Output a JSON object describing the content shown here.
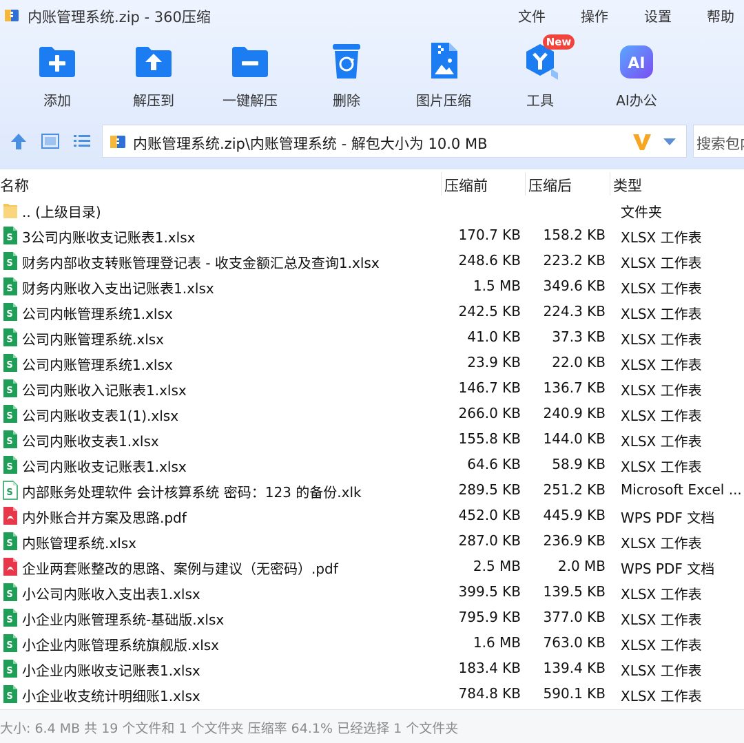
{
  "window": {
    "title": "内账管理系统.zip - 360压缩"
  },
  "menu": [
    "文件",
    "操作",
    "设置",
    "帮助"
  ],
  "toolbar": {
    "buttons": [
      {
        "label": "添加",
        "icon": "add-folder-icon"
      },
      {
        "label": "解压到",
        "icon": "extract-to-icon"
      },
      {
        "label": "一键解压",
        "icon": "one-click-extract-icon"
      },
      {
        "label": "删除",
        "icon": "trash-icon"
      },
      {
        "label": "图片压缩",
        "icon": "image-compress-icon"
      },
      {
        "label": "工具",
        "icon": "tools-icon"
      },
      {
        "label": "AI办公",
        "icon": "ai-office-icon"
      }
    ],
    "new_badge": "New",
    "ai_icon_text": "AI"
  },
  "address": {
    "path": "内账管理系统.zip\\内账管理系统 - 解包大小为 10.0 MB",
    "search_placeholder": "搜索包内"
  },
  "columns": {
    "name": "名称",
    "before": "压缩前",
    "after": "压缩后",
    "type": "类型"
  },
  "files": [
    {
      "name": ".. (上级目录)",
      "before": "",
      "after": "",
      "type": "文件夹",
      "icon": "folder"
    },
    {
      "name": "3公司内账收支记账表1.xlsx",
      "before": "170.7 KB",
      "after": "158.2 KB",
      "type": "XLSX 工作表",
      "icon": "xlsx"
    },
    {
      "name": "财务内部收支转账管理登记表 - 收支金额汇总及查询1.xlsx",
      "before": "248.6 KB",
      "after": "223.2 KB",
      "type": "XLSX 工作表",
      "icon": "xlsx"
    },
    {
      "name": "财务内账收入支出记账表1.xlsx",
      "before": "1.5 MB",
      "after": "349.6 KB",
      "type": "XLSX 工作表",
      "icon": "xlsx"
    },
    {
      "name": "公司内帐管理系统1.xlsx",
      "before": "242.5 KB",
      "after": "224.3 KB",
      "type": "XLSX 工作表",
      "icon": "xlsx"
    },
    {
      "name": "公司内账管理系统.xlsx",
      "before": "41.0 KB",
      "after": "37.3 KB",
      "type": "XLSX 工作表",
      "icon": "xlsx"
    },
    {
      "name": "公司内账管理系统1.xlsx",
      "before": "23.9 KB",
      "after": "22.0 KB",
      "type": "XLSX 工作表",
      "icon": "xlsx"
    },
    {
      "name": "公司内账收入记账表1.xlsx",
      "before": "146.7 KB",
      "after": "136.7 KB",
      "type": "XLSX 工作表",
      "icon": "xlsx"
    },
    {
      "name": "公司内账收支表1(1).xlsx",
      "before": "266.0 KB",
      "after": "240.9 KB",
      "type": "XLSX 工作表",
      "icon": "xlsx"
    },
    {
      "name": "公司内账收支表1.xlsx",
      "before": "155.8 KB",
      "after": "144.0 KB",
      "type": "XLSX 工作表",
      "icon": "xlsx"
    },
    {
      "name": "公司内账收支记账表1.xlsx",
      "before": "64.6 KB",
      "after": "58.9 KB",
      "type": "XLSX 工作表",
      "icon": "xlsx"
    },
    {
      "name": "内部账务处理软件 会计核算系统 密码：123 的备份.xlk",
      "before": "289.5 KB",
      "after": "251.2 KB",
      "type": "Microsoft Excel ...",
      "icon": "xlk"
    },
    {
      "name": "内外账合并方案及思路.pdf",
      "before": "452.0 KB",
      "after": "445.9 KB",
      "type": "WPS PDF 文档",
      "icon": "pdf"
    },
    {
      "name": "内账管理系统.xlsx",
      "before": "287.0 KB",
      "after": "236.9 KB",
      "type": "XLSX 工作表",
      "icon": "xlsx"
    },
    {
      "name": "企业两套账整改的思路、案例与建议（无密码）.pdf",
      "before": "2.5 MB",
      "after": "2.0 MB",
      "type": "WPS PDF 文档",
      "icon": "pdf"
    },
    {
      "name": "小公司内账收入支出表1.xlsx",
      "before": "399.5 KB",
      "after": "139.5 KB",
      "type": "XLSX 工作表",
      "icon": "xlsx"
    },
    {
      "name": "小企业内账管理系统-基础版.xlsx",
      "before": "795.9 KB",
      "after": "377.0 KB",
      "type": "XLSX 工作表",
      "icon": "xlsx"
    },
    {
      "name": "小企业内账管理系统旗舰版.xlsx",
      "before": "1.6 MB",
      "after": "763.0 KB",
      "type": "XLSX 工作表",
      "icon": "xlsx"
    },
    {
      "name": "小企业内账收支记账表1.xlsx",
      "before": "183.4 KB",
      "after": "139.4 KB",
      "type": "XLSX 工作表",
      "icon": "xlsx"
    },
    {
      "name": "小企业收支统计明细账1.xlsx",
      "before": "784.8 KB",
      "after": "590.1 KB",
      "type": "XLSX 工作表",
      "icon": "xlsx"
    }
  ],
  "status": {
    "text": "大小: 6.4 MB 共 19 个文件和 1 个文件夹 压缩率 64.1% 已经选择 1 个文件夹"
  },
  "colors": {
    "accent": "#1c7cf2",
    "xlsx": "#1f9e57",
    "pdf": "#e8364a",
    "folder": "#f6c65a",
    "vee": "#f5a623"
  }
}
